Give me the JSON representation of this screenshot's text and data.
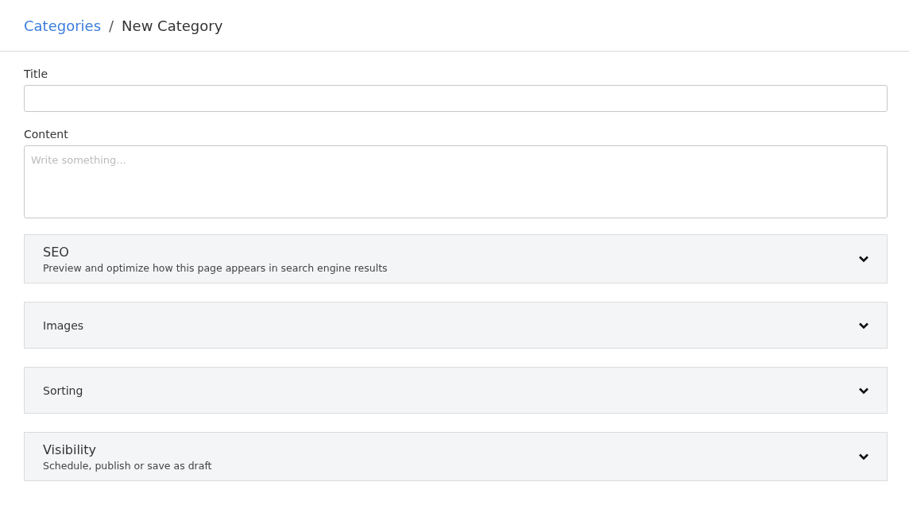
{
  "breadcrumb": {
    "parent": "Categories",
    "separator": "/",
    "current": "New Category"
  },
  "fields": [
    {
      "kind": "input",
      "label": "Title"
    },
    {
      "kind": "textarea",
      "label": "Content",
      "placeholder": "Write something..."
    }
  ],
  "sections": [
    {
      "title": "SEO",
      "subtitle": "Preview and optimize how this page appears in search engine results",
      "expanded": false
    },
    {
      "title": "Images",
      "expanded": false
    },
    {
      "title": "Sorting",
      "expanded": false
    },
    {
      "title": "Visibility",
      "subtitle": "Schedule, publish or save as draft",
      "expanded": false
    }
  ]
}
